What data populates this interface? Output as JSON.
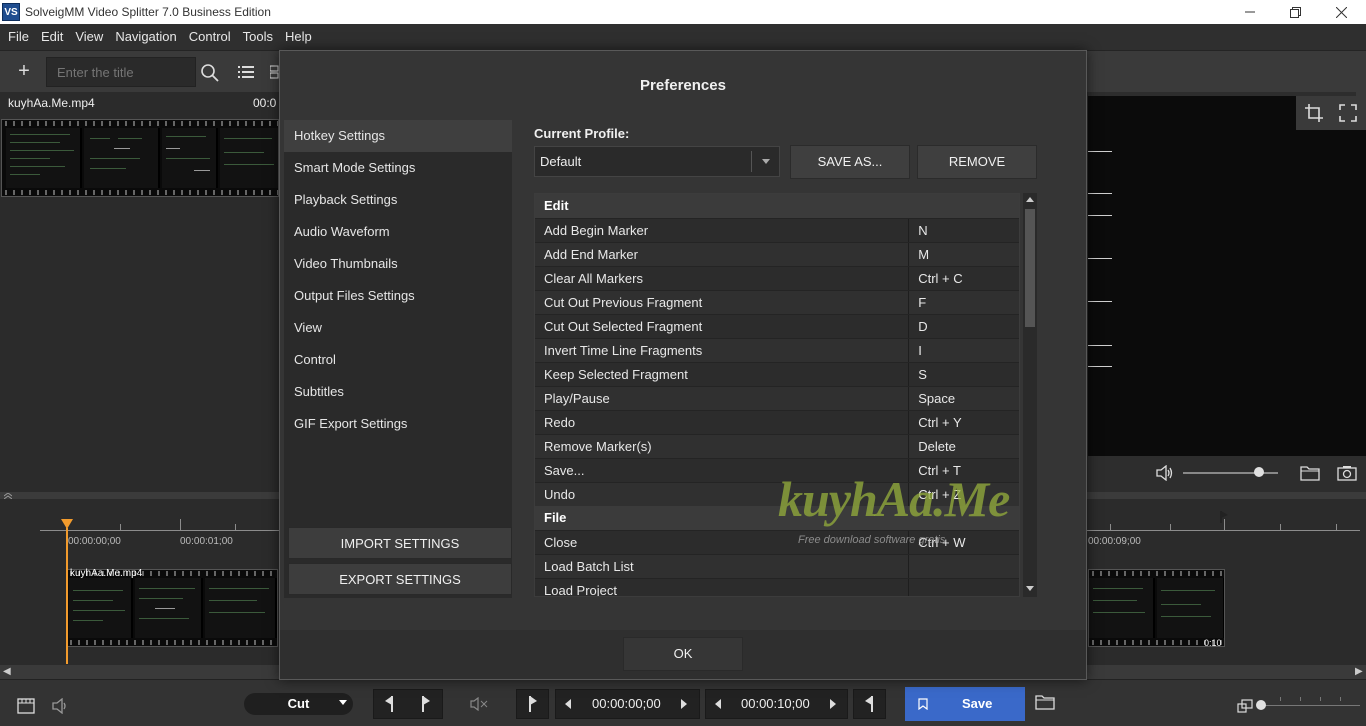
{
  "window": {
    "logo": "VS",
    "title": "SolveigMM Video Splitter 7.0 Business Edition",
    "minimize_icon": "minimize-icon",
    "maximize_icon": "restore-icon",
    "close_icon": "close-icon"
  },
  "menu": [
    "File",
    "Edit",
    "View",
    "Navigation",
    "Control",
    "Tools",
    "Help"
  ],
  "toolbar": {
    "search_placeholder": "Enter the title",
    "add_icon": "plus-icon"
  },
  "media": {
    "filename": "kuyhAa.Me.mp4",
    "duration_partial": "00:0"
  },
  "timeline": {
    "time_labels": [
      "00:00:00;00",
      "00:00:01;00",
      "00:00:09;00"
    ],
    "clip_filename": "kuyhAa.Me.mp4",
    "clip_duration": "0:10"
  },
  "bottom_bar": {
    "mode": "Cut",
    "start_time": "00:00:00;00",
    "end_time": "00:00:10;00",
    "save_label": "Save"
  },
  "dialog": {
    "title": "Preferences",
    "nav_items": [
      "Hotkey Settings",
      "Smart Mode Settings",
      "Playback Settings",
      "Audio Waveform",
      "Video Thumbnails",
      "Output Files Settings",
      "View",
      "Control",
      "Subtitles",
      "GIF Export Settings"
    ],
    "active_nav": "Hotkey Settings",
    "import_label": "IMPORT SETTINGS",
    "export_label": "EXPORT SETTINGS",
    "profile_label": "Current Profile:",
    "profile_value": "Default",
    "save_as_label": "SAVE AS...",
    "remove_label": "REMOVE",
    "hotkey_rows": [
      {
        "type": "group",
        "label": "Edit"
      },
      {
        "type": "item",
        "action": "Add Begin Marker",
        "key": "N"
      },
      {
        "type": "item",
        "action": "Add End Marker",
        "key": "M"
      },
      {
        "type": "item",
        "action": "Clear All Markers",
        "key": "Ctrl + C"
      },
      {
        "type": "item",
        "action": "Cut Out Previous Fragment",
        "key": "F"
      },
      {
        "type": "item",
        "action": "Cut Out Selected Fragment",
        "key": "D"
      },
      {
        "type": "item",
        "action": "Invert Time Line Fragments",
        "key": "I"
      },
      {
        "type": "item",
        "action": "Keep Selected Fragment",
        "key": "S"
      },
      {
        "type": "item",
        "action": "Play/Pause",
        "key": "Space"
      },
      {
        "type": "item",
        "action": "Redo",
        "key": "Ctrl + Y"
      },
      {
        "type": "item",
        "action": "Remove Marker(s)",
        "key": "Delete"
      },
      {
        "type": "item",
        "action": "Save...",
        "key": "Ctrl + T"
      },
      {
        "type": "item",
        "action": "Undo",
        "key": "Ctrl + Z"
      },
      {
        "type": "group",
        "label": "File"
      },
      {
        "type": "item",
        "action": "Close",
        "key": "Ctrl + W"
      },
      {
        "type": "item",
        "action": "Load Batch List",
        "key": ""
      },
      {
        "type": "item",
        "action": "Load Project",
        "key": ""
      }
    ],
    "ok_label": "OK"
  },
  "watermark": {
    "logo": "kuyhAa.Me",
    "tagline": "Free download software gratis"
  },
  "colors": {
    "accent": "#3a69c9",
    "playhead": "#f29b2d",
    "background": "#2d2d2d",
    "dialog": "#353535"
  }
}
